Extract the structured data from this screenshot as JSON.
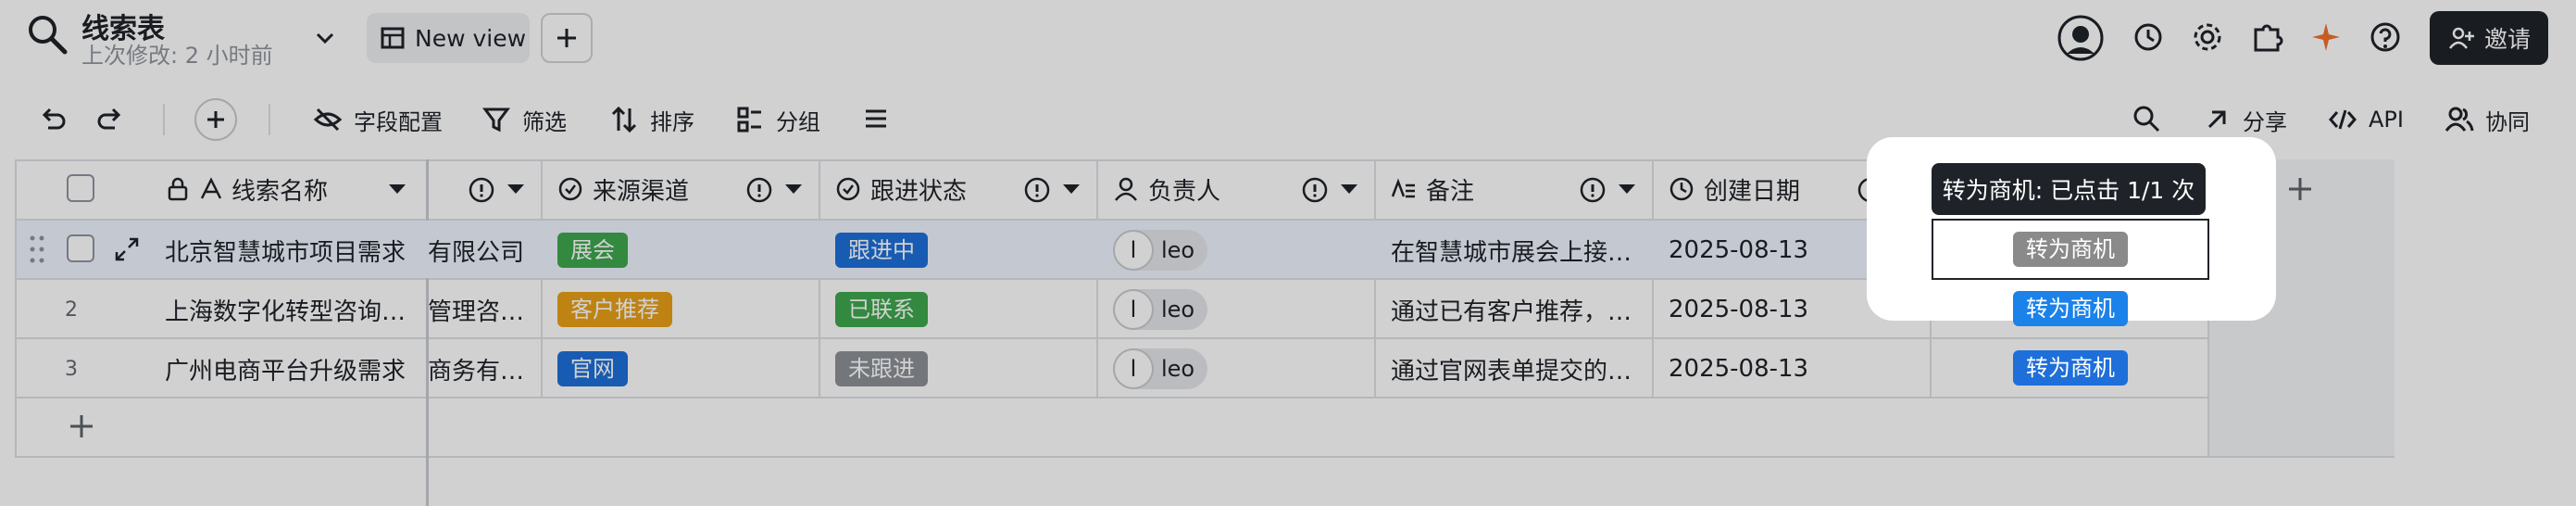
{
  "header": {
    "title": "线索表",
    "last_modified": "上次修改:  2 小时前",
    "view_label": "New view",
    "invite_label": "邀请"
  },
  "toolbar": {
    "field_config": "字段配置",
    "filter": "筛选",
    "sort": "排序",
    "group": "分组",
    "share": "分享",
    "api": "API",
    "collab": "协同"
  },
  "columns": {
    "name": "线索名称",
    "source": "来源渠道",
    "status": "跟进状态",
    "owner": "负责人",
    "note": "备注",
    "created": "创建日期",
    "action": "转为商机"
  },
  "rows": [
    {
      "num": "",
      "name": "北京智慧城市项目需求",
      "company": "有限公司",
      "source": "展会",
      "status": "跟进中",
      "owner_initial": "l",
      "owner": "leo",
      "note": "在智慧城市展会上接…",
      "created": "2025-08-13",
      "action": "转为商机"
    },
    {
      "num": "2",
      "name": "上海数字化转型咨询…",
      "company": "管理咨…",
      "source": "客户推荐",
      "status": "已联系",
      "owner_initial": "l",
      "owner": "leo",
      "note": "通过已有客户推荐，…",
      "created": "2025-08-13",
      "action": "转为商机"
    },
    {
      "num": "3",
      "name": "广州电商平台升级需求",
      "company": "商务有…",
      "source": "官网",
      "status": "未跟进",
      "owner_initial": "l",
      "owner": "leo",
      "note": "通过官网表单提交的…",
      "created": "2025-08-13",
      "action": "转为商机"
    }
  ],
  "tooltip": "转为商机: 已点击 1/1 次",
  "colors": {
    "tag_green": "#3da84d",
    "tag_orange": "#e8a018",
    "tag_blue": "#1e6fd9",
    "tag_gray": "#8d9197",
    "button_blue": "#1b82ea",
    "button_gray": "#8a8a8a"
  }
}
